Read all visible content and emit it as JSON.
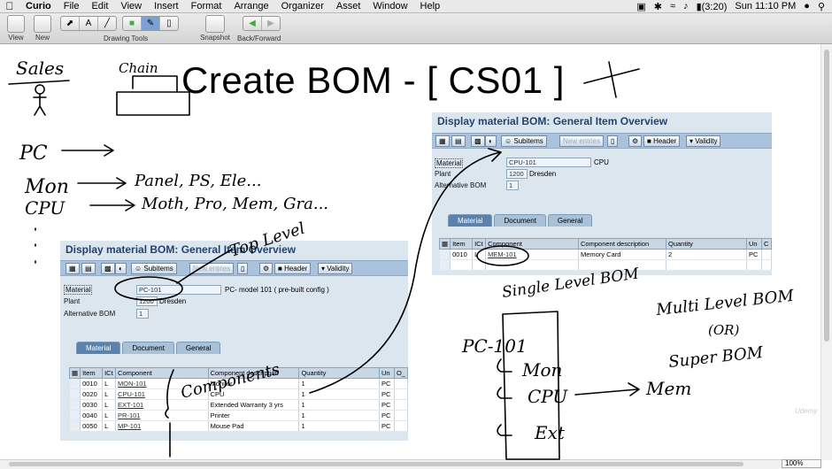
{
  "menubar": {
    "app": "Curio",
    "items": [
      "File",
      "Edit",
      "View",
      "Insert",
      "Format",
      "Arrange",
      "Organizer",
      "Asset",
      "Window",
      "Help"
    ],
    "battery": "(3:20)",
    "clock": "Sun 11:10 PM"
  },
  "toolbar": {
    "view_label": "View",
    "new_label": "New",
    "drawing_tools_label": "Drawing Tools",
    "snapshot_label": "Snapshot",
    "back_forward_label": "Back/Forward"
  },
  "slide": {
    "title": "Create BOM - [ CS01 ]"
  },
  "sap_left": {
    "title": "Display material BOM: General Item Overview",
    "buttons": {
      "subitems": "Subitems",
      "new_entries": "New entries",
      "header": "Header",
      "validity": "Validity"
    },
    "material_label": "Material",
    "material_value": "PC-101",
    "material_desc": "PC- model 101 ( pre-built config )",
    "plant_label": "Plant",
    "plant_value": "1200",
    "plant_name": "Dresden",
    "altbom_label": "Alternative BOM",
    "altbom_value": "1",
    "tabs": [
      "Material",
      "Document",
      "General"
    ],
    "columns": [
      "Item",
      "ICt",
      "Component",
      "Component description",
      "Quantity",
      "Un",
      "O_"
    ],
    "rows": [
      {
        "item": "0010",
        "ict": "L",
        "comp": "MON-101",
        "desc": "Monitor",
        "qty": "1",
        "un": "PC"
      },
      {
        "item": "0020",
        "ict": "L",
        "comp": "CPU-101",
        "desc": "CPU",
        "qty": "1",
        "un": "PC"
      },
      {
        "item": "0030",
        "ict": "L",
        "comp": "EXT-101",
        "desc": "Extended Warranty 3 yrs",
        "qty": "1",
        "un": "PC"
      },
      {
        "item": "0040",
        "ict": "L",
        "comp": "PR-101",
        "desc": "Printer",
        "qty": "1",
        "un": "PC"
      },
      {
        "item": "0050",
        "ict": "L",
        "comp": "MP-101",
        "desc": "Mouse Pad",
        "qty": "1",
        "un": "PC"
      }
    ]
  },
  "sap_right": {
    "title": "Display material BOM: General Item Overview",
    "buttons": {
      "subitems": "Subitems",
      "new_entries": "New entries",
      "header": "Header",
      "validity": "Validity"
    },
    "material_label": "Material",
    "material_value": "CPU-101",
    "material_desc": "CPU",
    "plant_label": "Plant",
    "plant_value": "1200",
    "plant_name": "Dresden",
    "altbom_label": "Alternative BOM",
    "altbom_value": "1",
    "tabs": [
      "Material",
      "Document",
      "General"
    ],
    "columns": [
      "Item",
      "ICt",
      "Component",
      "Component description",
      "Quantity",
      "Un",
      "C"
    ],
    "rows": [
      {
        "item": "0010",
        "ict": "L",
        "comp": "MEM-101",
        "desc": "Memory Card",
        "qty": "2",
        "un": "PC"
      }
    ]
  },
  "handwriting": {
    "sales": "Sales",
    "chain": "Chain",
    "pc": "PC",
    "mon": "Mon",
    "cpu": "CPU",
    "mon_parts": "Panel, PS, Ele...",
    "cpu_parts": "Moth, Pro, Mem, Gra...",
    "top_level": "Top Level",
    "components": "Components",
    "single_level": "Single Level BOM",
    "multi_level": "Multi Level BOM",
    "or": "(OR)",
    "super_bom": "Super BOM",
    "tree_root": "PC-101",
    "tree_mon": "Mon",
    "tree_cpu": "CPU",
    "tree_ext": "Ext",
    "tree_mem": "Mem"
  },
  "status": {
    "zoom": "100%"
  },
  "colors": {
    "sap_title": "#23436e",
    "sap_bg": "#dce6ef",
    "ink": "#000000"
  }
}
